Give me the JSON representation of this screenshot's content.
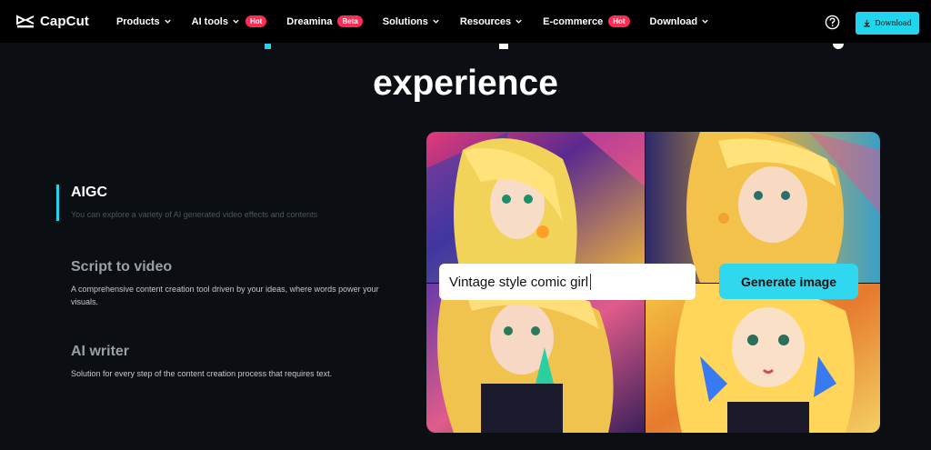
{
  "nav": {
    "brand": "CapCut",
    "items": [
      {
        "label": "Products",
        "dropdown": true,
        "badge": ""
      },
      {
        "label": "AI tools",
        "dropdown": true,
        "badge": "Hot"
      },
      {
        "label": "Dreamina",
        "dropdown": false,
        "badge": "Beta"
      },
      {
        "label": "Solutions",
        "dropdown": true,
        "badge": ""
      },
      {
        "label": "Resources",
        "dropdown": true,
        "badge": ""
      },
      {
        "label": "E-commerce",
        "dropdown": false,
        "badge": "Hot"
      },
      {
        "label": "Download",
        "dropdown": true,
        "badge": ""
      }
    ],
    "download_label": "Download",
    "help_icon": "question-circle-icon",
    "download_icon": "download-arrow-icon"
  },
  "hero": {
    "headline": "experience"
  },
  "features": [
    {
      "title": "AIGC",
      "desc": "You can explore a variety of AI generated video effects and contents",
      "active": true
    },
    {
      "title": "Script to video",
      "desc": "A comprehensive content creation tool driven by your ideas, where words power your visuals.",
      "active": false
    },
    {
      "title": "AI writer",
      "desc": "Solution for every step of the content creation process that requires text.",
      "active": false
    }
  ],
  "generator": {
    "prompt_value": "Vintage style comic girl",
    "generate_label": "Generate image"
  },
  "colors": {
    "accent": "#20d5ec",
    "badge": "#fe2c55",
    "background": "#0b0e13"
  }
}
